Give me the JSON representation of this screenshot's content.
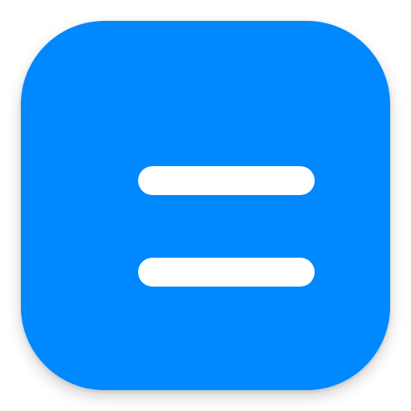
{
  "app_icon": {
    "name": "equals-app-icon",
    "background_color": "#0088FF",
    "glyph": "equals",
    "glyph_color": "#FFFFFF"
  }
}
